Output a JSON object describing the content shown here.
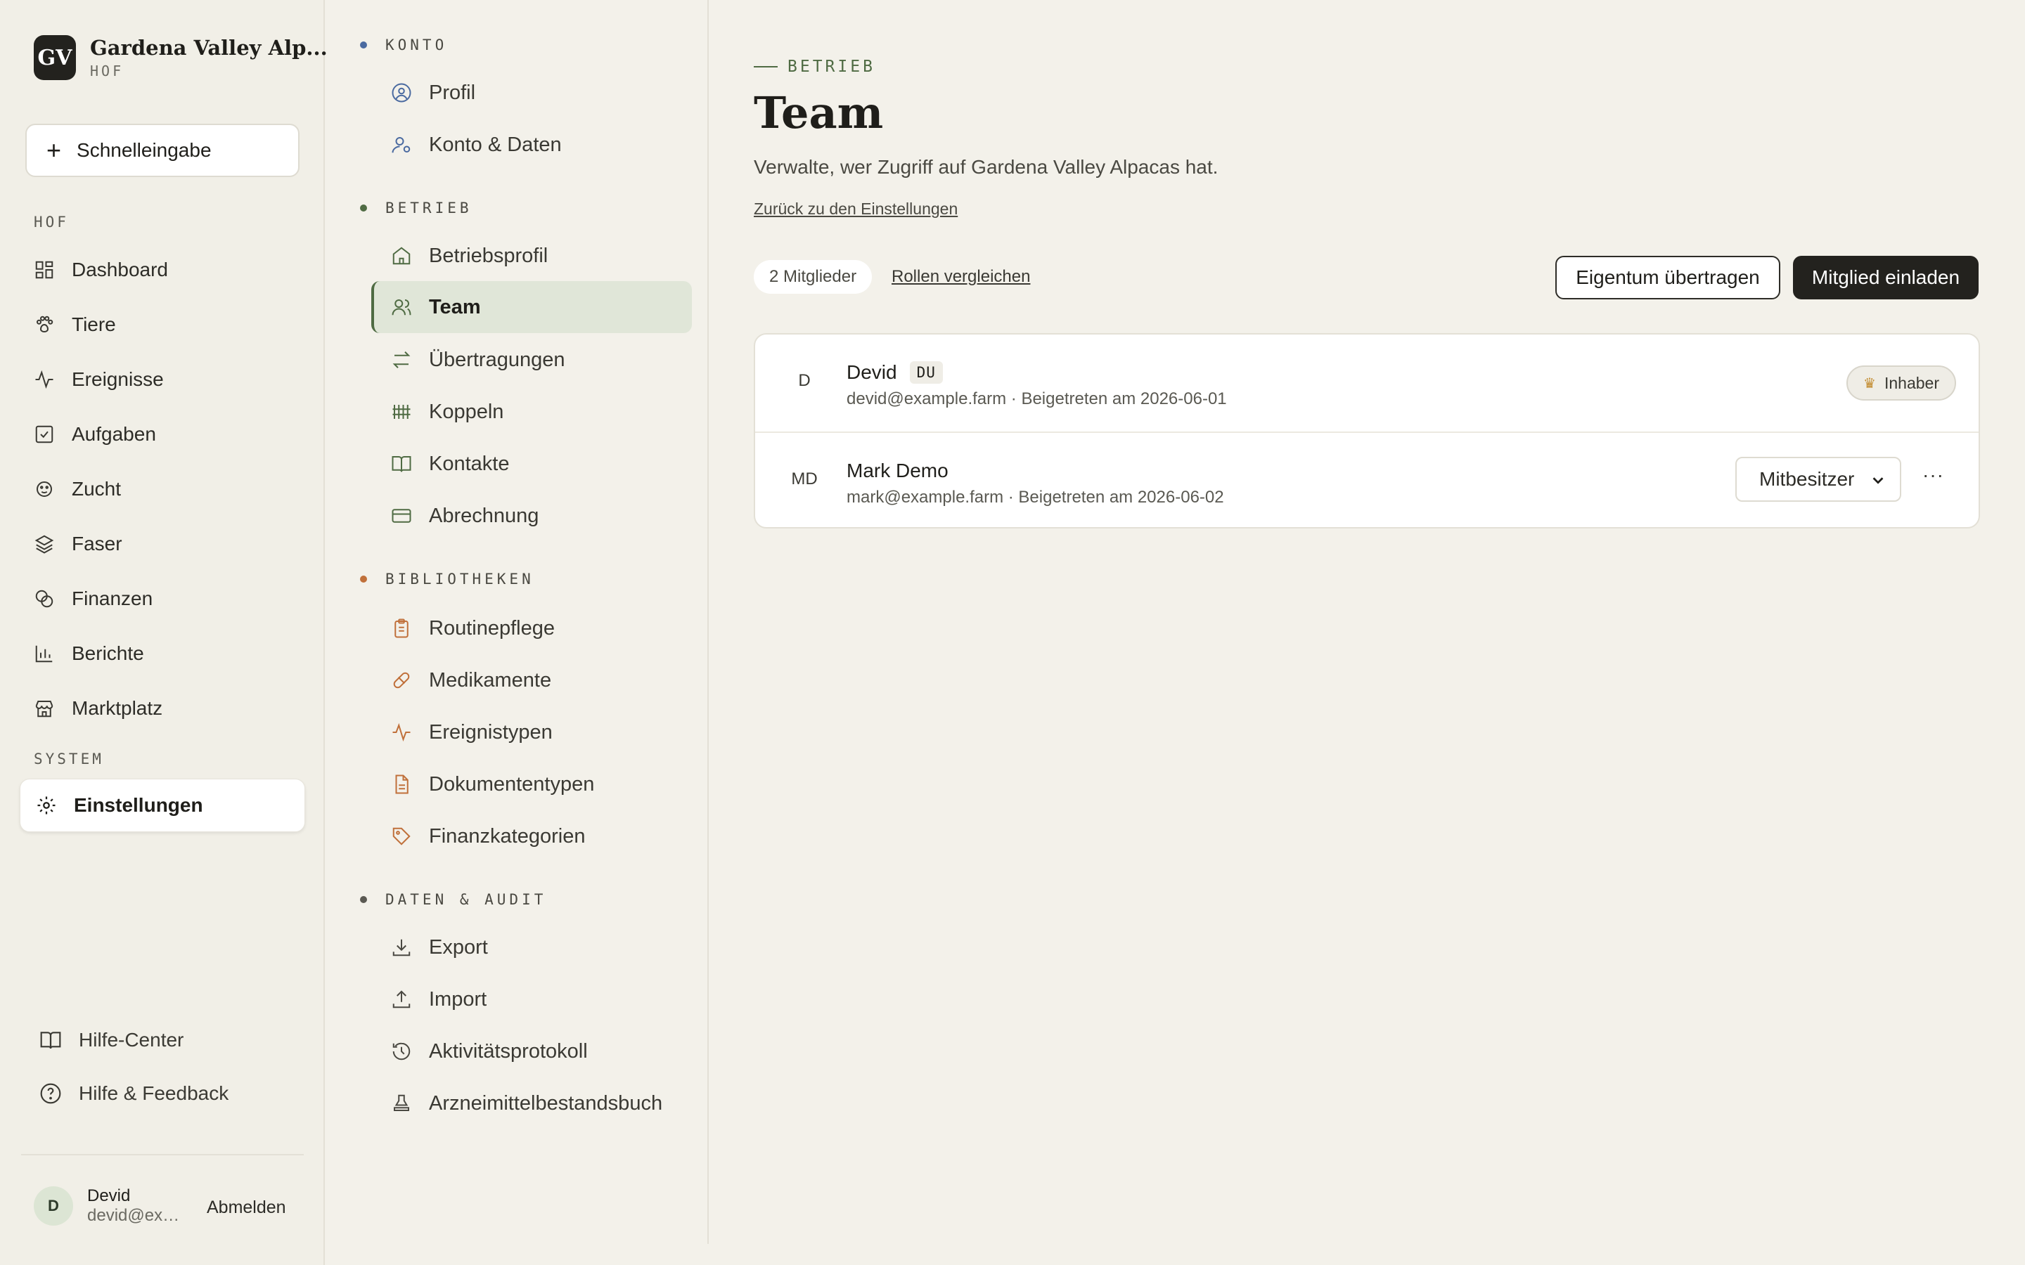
{
  "brand": {
    "logo": "GV",
    "name": "Gardena Valley Alp...",
    "sub": "HOF"
  },
  "quick": {
    "label": "Schnelleingabe"
  },
  "sidebar": {
    "section_hof": "HOF",
    "items": [
      {
        "label": "Dashboard",
        "icon": "dashboard-icon"
      },
      {
        "label": "Tiere",
        "icon": "paw-icon"
      },
      {
        "label": "Ereignisse",
        "icon": "activity-icon"
      },
      {
        "label": "Aufgaben",
        "icon": "checkbox-icon"
      },
      {
        "label": "Zucht",
        "icon": "breeding-icon"
      },
      {
        "label": "Faser",
        "icon": "layers-icon"
      },
      {
        "label": "Finanzen",
        "icon": "coins-icon"
      },
      {
        "label": "Berichte",
        "icon": "bar-chart-icon"
      },
      {
        "label": "Marktplatz",
        "icon": "store-icon"
      }
    ],
    "section_system": "SYSTEM",
    "settings": "Einstellungen",
    "help_center": "Hilfe-Center",
    "help_feedback": "Hilfe & Feedback",
    "user": {
      "initial": "D",
      "name": "Devid",
      "email": "devid@example.farm",
      "logout": "Abmelden"
    }
  },
  "settings": {
    "konto": "KONTO",
    "konto_items": [
      "Profil",
      "Konto & Daten"
    ],
    "betrieb": "BETRIEB",
    "betrieb_items": [
      "Betriebsprofil",
      "Team",
      "Übertragungen",
      "Koppeln",
      "Kontakte",
      "Abrechnung"
    ],
    "bibliotheken": "BIBLIOTHEKEN",
    "bibliotheken_items": [
      "Routinepflege",
      "Medikamente",
      "Ereignistypen",
      "Dokumententypen",
      "Finanzkategorien"
    ],
    "daten": "DATEN & AUDIT",
    "daten_items": [
      "Export",
      "Import",
      "Aktivitätsprotokoll",
      "Arzneimittelbestandsbuch"
    ]
  },
  "main": {
    "eyebrow": "BETRIEB",
    "title": "Team",
    "subtitle": "Verwalte, wer Zugriff auf Gardena Valley Alpacas hat.",
    "back": "Zurück zu den Einstellungen",
    "members_count": "2 Mitglieder",
    "compare": "Rollen vergleichen",
    "transfer": "Eigentum übertragen",
    "invite": "Mitglied einladen",
    "members": [
      {
        "initials": "D",
        "name": "Devid",
        "you": "DU",
        "meta": "devid@example.farm · Beigetreten am 2026-06-01",
        "role_badge": "Inhaber"
      },
      {
        "initials": "MD",
        "name": "Mark Demo",
        "meta": "mark@example.farm · Beigetreten am 2026-06-02",
        "role": "Mitbesitzer",
        "more": "···"
      }
    ]
  },
  "colors": {
    "accent": "#4f6b43",
    "bibliothek": "#c0703a",
    "dark": "#23221e"
  }
}
